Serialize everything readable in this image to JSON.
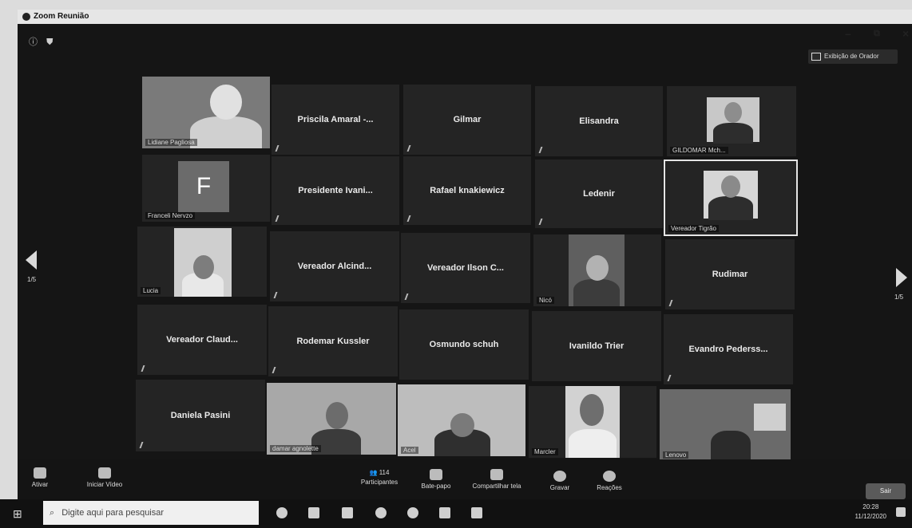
{
  "window": {
    "title": "Zoom Reunião"
  },
  "view_button": {
    "label": "Exibição de Orador"
  },
  "pager": {
    "left": "1/5",
    "right": "1/5"
  },
  "tiles": [
    {
      "label": "Lidiane Pagliosa"
    },
    {
      "name": "Priscila Amaral -..."
    },
    {
      "name": "Gilmar"
    },
    {
      "name": "Elisandra"
    },
    {
      "label": "GILDOMAR Mch..."
    },
    {
      "letter": "F",
      "label": "Franceli Nervzo"
    },
    {
      "name": "Presidente Ivani..."
    },
    {
      "name": "Rafael knakiewicz"
    },
    {
      "name": "Ledenir"
    },
    {
      "label": "Vereador Tigrão"
    },
    {
      "label": "Lucia"
    },
    {
      "name": "Vereador Alcind..."
    },
    {
      "name": "Vereador Ilson C..."
    },
    {
      "label": "Nicó"
    },
    {
      "name": "Rudimar"
    },
    {
      "name": "Vereador Claud..."
    },
    {
      "name": "Rodemar Kussler"
    },
    {
      "name": "Osmundo schuh"
    },
    {
      "name": "Ivanildo Trier"
    },
    {
      "name": "Evandro Pederss..."
    },
    {
      "name": "Daniela Pasini"
    },
    {
      "label": "damar agnolette"
    },
    {
      "label": "Acel"
    },
    {
      "label": "Marcler"
    },
    {
      "label": "Lenovo"
    }
  ],
  "toolbar": {
    "unmute": "Ativar",
    "start_video": "Iniciar Vídeo",
    "participants": "Participantes",
    "participants_count": "114",
    "chat": "Bate-papo",
    "share": "Compartilhar tela",
    "record": "Gravar",
    "reactions": "Reações",
    "leave": "Sair"
  },
  "taskbar": {
    "search_placeholder": "Digite aqui para pesquisar",
    "time": "20:28",
    "date": "11/12/2020"
  }
}
